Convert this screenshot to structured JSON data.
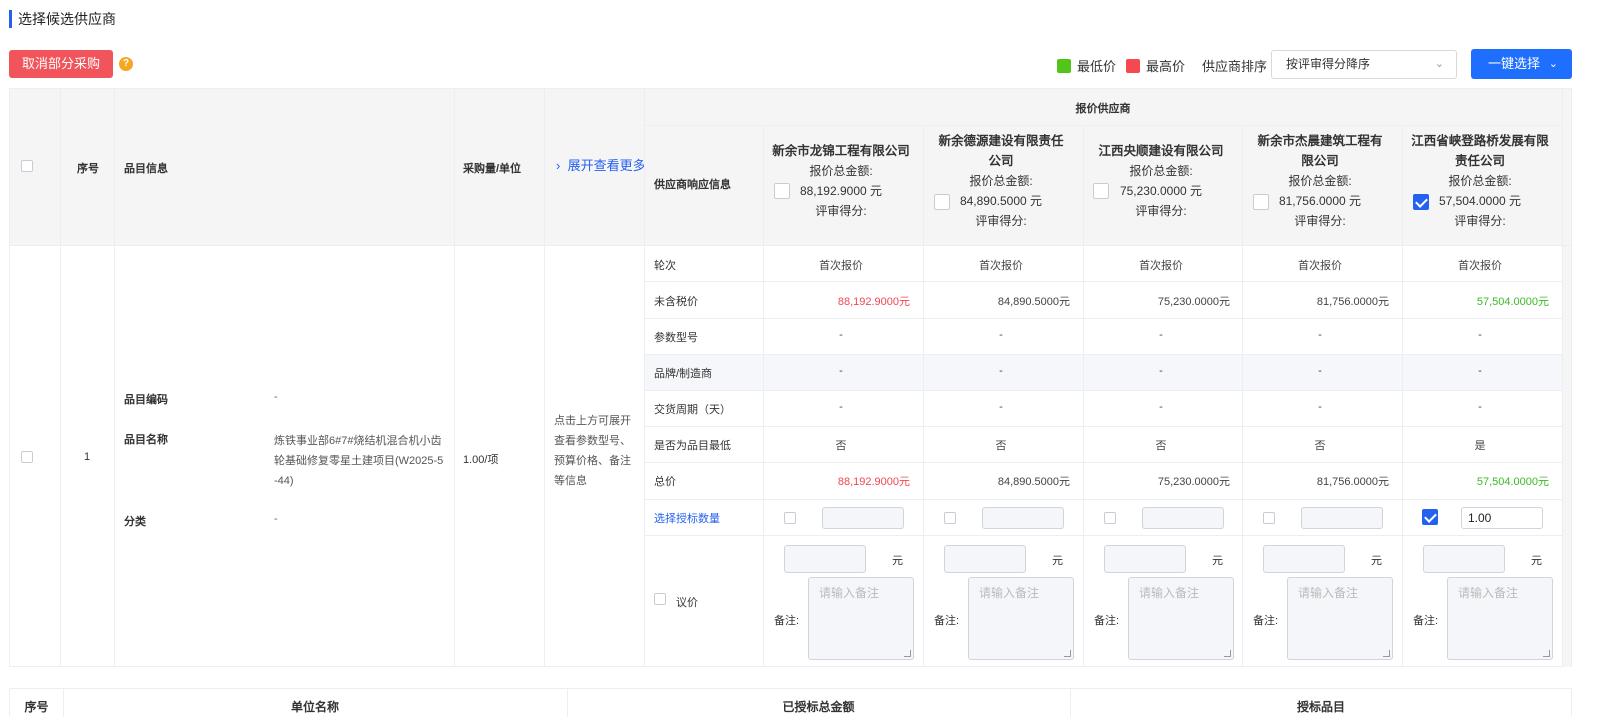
{
  "page_title": "选择候选供应商",
  "toolbar": {
    "cancel_partial": "取消部分采购",
    "help": "?",
    "legend_low": "最低价",
    "legend_high": "最高价",
    "low_color": "#52c41a",
    "high_color": "#f5484f",
    "sort_label": "供应商排序",
    "sort_value": "按评审得分降序",
    "one_click": "一键选择"
  },
  "table": {
    "headers": {
      "index": "序号",
      "item_info": "品目信息",
      "qty_unit": "采购量/单位",
      "expand": "展开查看更多",
      "response_info": "供应商响应信息",
      "quote_suppliers": "报价供应商"
    },
    "suppliers": [
      {
        "name": "新余市龙锦工程有限公司",
        "total_label": "报价总金额:",
        "total": "88,192.9000 元",
        "score_label": "评审得分:",
        "checked": false
      },
      {
        "name": "新余德源建设有限责任公司",
        "total_label": "报价总金额:",
        "total": "84,890.5000 元",
        "score_label": "评审得分:",
        "checked": false
      },
      {
        "name": "江西央顺建设有限公司",
        "total_label": "报价总金额:",
        "total": "75,230.0000 元",
        "score_label": "评审得分:",
        "checked": false
      },
      {
        "name": "新余市杰晨建筑工程有限公司",
        "total_label": "报价总金额:",
        "total": "81,756.0000 元",
        "score_label": "评审得分:",
        "checked": false
      },
      {
        "name": "江西省峡登路桥发展有限责任公司",
        "total_label": "报价总金额:",
        "total": "57,504.0000 元",
        "score_label": "评审得分:",
        "checked": true
      }
    ],
    "row": {
      "index": "1",
      "item_code_label": "品目编码",
      "item_code": "-",
      "item_name_label": "品目名称",
      "item_name": "炼铁事业部6#7#烧结机混合机小齿轮基础修复零星土建项目(W2025-5-44)",
      "category_label": "分类",
      "category": "-",
      "qty": "1.00/项",
      "expand_hint": "点击上方可展开查看参数型号、预算价格、备注等信息"
    },
    "row_labels": {
      "round": "轮次",
      "pretax": "未含税价",
      "model": "参数型号",
      "brand": "品牌/制造商",
      "delivery": "交货周期（天）",
      "is_lowest": "是否为品目最低",
      "total": "总价",
      "select_qty": "选择授标数量",
      "negotiate": "议价"
    },
    "cells": {
      "round": [
        "首次报价",
        "首次报价",
        "首次报价",
        "首次报价",
        "首次报价"
      ],
      "pretax": [
        "88,192.9000元",
        "84,890.5000元",
        "75,230.0000元",
        "81,756.0000元",
        "57,504.0000元"
      ],
      "model": [
        "-",
        "-",
        "-",
        "-",
        "-"
      ],
      "brand": [
        "-",
        "-",
        "-",
        "-",
        "-"
      ],
      "delivery": [
        "-",
        "-",
        "-",
        "-",
        "-"
      ],
      "is_lowest": [
        "否",
        "否",
        "否",
        "否",
        "是"
      ],
      "total": [
        "88,192.9000元",
        "84,890.5000元",
        "75,230.0000元",
        "81,756.0000元",
        "57,504.0000元"
      ],
      "select_qty": [
        "",
        "",
        "",
        "",
        "1.00"
      ]
    },
    "negotiate": {
      "unit": "元",
      "remark_label": "备注:",
      "remark_placeholder": "请输入备注"
    }
  },
  "bottom_table": {
    "headers": [
      "序号",
      "单位名称",
      "已授标总金额",
      "授标品目"
    ]
  }
}
